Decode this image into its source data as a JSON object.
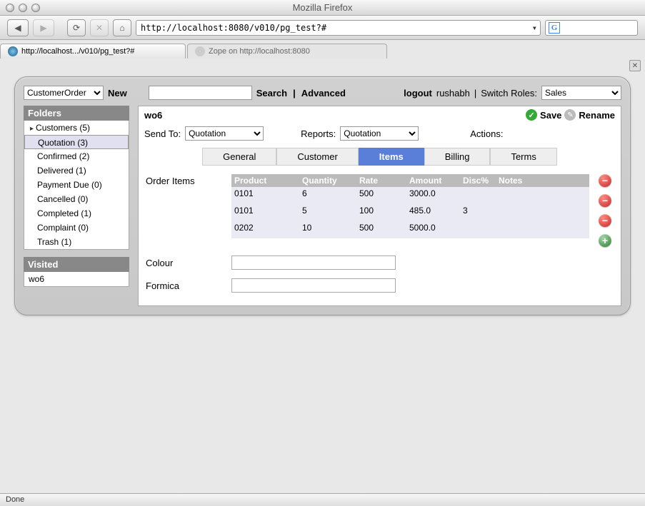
{
  "window": {
    "title": "Mozilla Firefox"
  },
  "url": "http://localhost:8080/v010/pg_test?#",
  "browser_tabs": [
    {
      "label": "http://localhost.../v010/pg_test?#",
      "active": true
    },
    {
      "label": "Zope on http://localhost:8080",
      "active": false
    }
  ],
  "toprow": {
    "type_select": "CustomerOrder",
    "new_link": "New",
    "search_value": "",
    "search_label": "Search",
    "advanced_label": "Advanced",
    "logout_label": "logout",
    "username": "rushabh",
    "switch_roles_label": "Switch Roles:",
    "role_select": "Sales"
  },
  "sidebar": {
    "folders_header": "Folders",
    "folders": [
      {
        "label": "Customers (5)",
        "parent": true
      },
      {
        "label": "Quotation (3)",
        "selected": true
      },
      {
        "label": "Confirmed (2)"
      },
      {
        "label": "Delivered (1)"
      },
      {
        "label": "Payment Due (0)"
      },
      {
        "label": "Cancelled (0)"
      },
      {
        "label": "Completed (1)"
      },
      {
        "label": "Complaint (0)"
      },
      {
        "label": "Trash (1)"
      }
    ],
    "visited_header": "Visited",
    "visited": [
      "wo6"
    ]
  },
  "main": {
    "record_title": "wo6",
    "save_label": "Save",
    "rename_label": "Rename",
    "send_to_label": "Send To:",
    "send_to_value": "Quotation",
    "reports_label": "Reports:",
    "reports_value": "Quotation",
    "actions_label": "Actions:",
    "tabs": [
      "General",
      "Customer",
      "Items",
      "Billing",
      "Terms"
    ],
    "active_tab": "Items",
    "order_items_label": "Order Items",
    "columns": {
      "product": "Product",
      "quantity": "Quantity",
      "rate": "Rate",
      "amount": "Amount",
      "disc": "Disc%",
      "notes": "Notes"
    },
    "rows": [
      {
        "product": "0101",
        "quantity": "6",
        "rate": "500",
        "amount": "3000.0",
        "disc": "",
        "notes": ""
      },
      {
        "product": "0101",
        "quantity": "5",
        "rate": "100",
        "amount": "485.0",
        "disc": "3",
        "notes": ""
      },
      {
        "product": "0202",
        "quantity": "10",
        "rate": "500",
        "amount": "5000.0",
        "disc": "",
        "notes": ""
      }
    ],
    "fields": {
      "colour_label": "Colour",
      "colour_value": "",
      "formica_label": "Formica",
      "formica_value": ""
    }
  },
  "status": "Done"
}
